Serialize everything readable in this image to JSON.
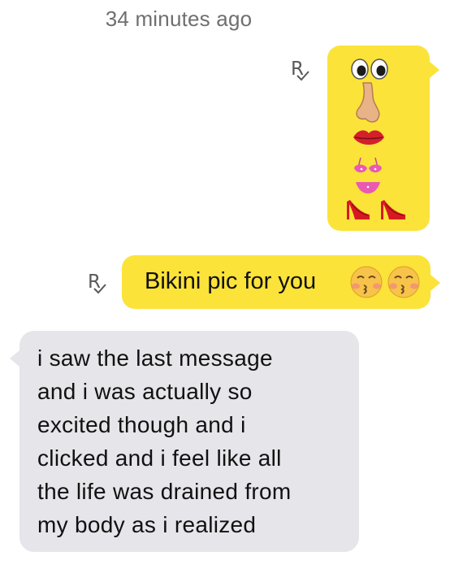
{
  "timestamp": "34 minutes ago",
  "read_receipt_symbol": "R",
  "messages": [
    {
      "direction": "outgoing",
      "type": "emoji",
      "emojis": [
        "eyes-emoji",
        "nose-emoji",
        "lips-emoji",
        "bikini-emoji",
        "high-heels-emoji"
      ]
    },
    {
      "direction": "outgoing",
      "type": "text",
      "text": "Bikini pic for you",
      "emojis": [
        "kissing-face-emoji",
        "kissing-face-emoji"
      ]
    },
    {
      "direction": "incoming",
      "type": "text",
      "lines": [
        "i saw the last message",
        "and i was actually so",
        "excited though and i",
        "clicked and i feel like all",
        "the life was drained from",
        "my body as i realized"
      ]
    }
  ],
  "colors": {
    "outgoing_bubble": "#fbe33a",
    "incoming_bubble": "#e5e5ea",
    "timestamp_text": "#6f6f6f"
  }
}
